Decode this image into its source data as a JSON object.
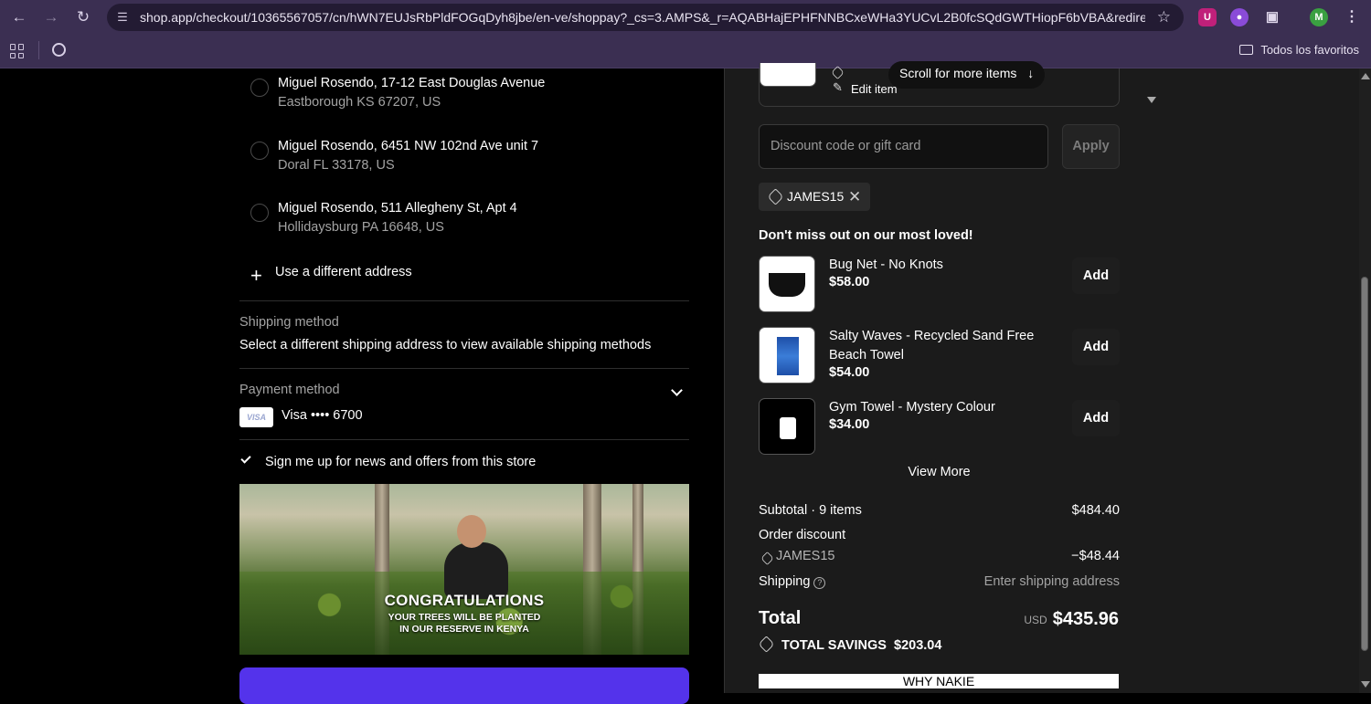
{
  "browser": {
    "url": "shop.app/checkout/10365567057/cn/hWN7EUJsRbPldFOGqDyh8jbe/en-ve/shoppay?_cs=3.AMPS&_r=AQABHajEPHFNNBCxeWHa3YUCvL2B0fcSQdGWTHiopF6bVBA&redirect_sour...",
    "bookmarks_label": "Todos los favoritos",
    "profile_initial": "M",
    "ext_1": "U"
  },
  "addresses": [
    {
      "line1": "Miguel Rosendo, 17-12 East Douglas Avenue",
      "line2": "Eastborough KS 67207, US"
    },
    {
      "line1": "Miguel Rosendo, 6451 NW 102nd Ave unit 7",
      "line2": "Doral FL 33178, US"
    },
    {
      "line1": "Miguel Rosendo, 511 Allegheny St, Apt 4",
      "line2": "Hollidaysburg PA 16648, US"
    }
  ],
  "use_different_address": "Use a different address",
  "shipping": {
    "heading": "Shipping method",
    "message": "Select a different shipping address to view available shipping methods"
  },
  "payment": {
    "heading": "Payment method",
    "card_brand": "VISA",
    "card_label": "Visa •••• 6700"
  },
  "newsletter_label": "Sign me up for news and offers from this store",
  "banner": {
    "title": "CONGRATULATIONS",
    "line1": "YOUR TREES WILL BE PLANTED",
    "line2": "IN OUR RESERVE IN KENYA"
  },
  "cart": {
    "scroll_hint": "Scroll for more items",
    "edit_item": "Edit item",
    "discount_placeholder": "Discount code or gift card",
    "apply_label": "Apply",
    "applied_code": "JAMES15",
    "upsell_heading": "Don't miss out on our most loved!",
    "add_label": "Add",
    "products": [
      {
        "name": "Bug Net - No Knots",
        "price": "$58.00"
      },
      {
        "name": "Salty Waves - Recycled Sand Free Beach Towel",
        "price": "$54.00"
      },
      {
        "name": "Gym Towel - Mystery Colour",
        "price": "$34.00"
      }
    ],
    "view_more": "View More",
    "subtotal_label": "Subtotal · 9 items",
    "subtotal_value": "$484.40",
    "order_discount_label": "Order discount",
    "discount_code": "JAMES15",
    "discount_value": "−$48.44",
    "shipping_label": "Shipping",
    "shipping_value": "Enter shipping address",
    "total_label": "Total",
    "total_currency": "USD",
    "total_value": "$435.96",
    "savings_label": "TOTAL SAVINGS",
    "savings_value": "$203.04",
    "why_label": "WHY NAKIE"
  }
}
